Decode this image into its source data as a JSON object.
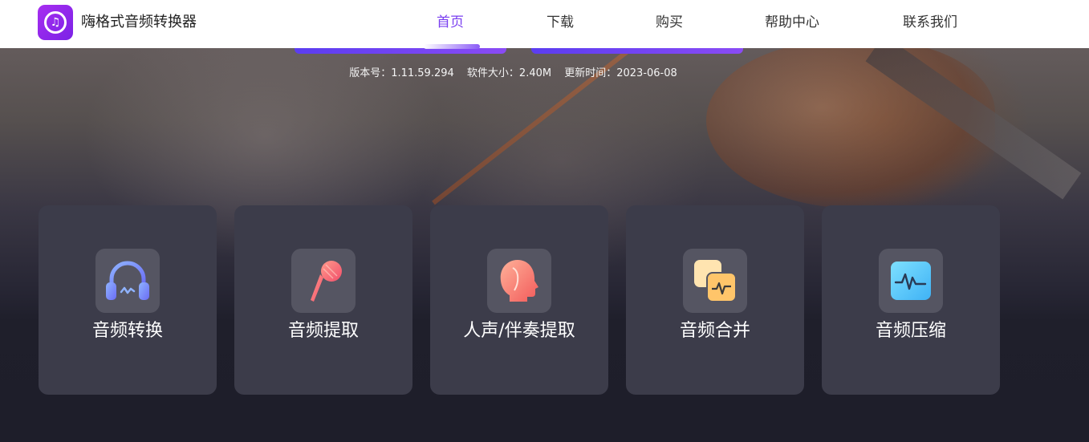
{
  "app": {
    "name": "嗨格式音频转换器",
    "logo_icon": "music-note-icon"
  },
  "nav": {
    "items": [
      {
        "label": "首页",
        "active": true
      },
      {
        "label": "下载",
        "active": false
      },
      {
        "label": "购买",
        "active": false
      },
      {
        "label": "帮助中心",
        "active": false
      },
      {
        "label": "联系我们",
        "active": false
      }
    ]
  },
  "colors": {
    "accent": "#7a3ff0",
    "card_bg": "#3c3c4a",
    "icon_box_bg": "#555562"
  },
  "version_info": {
    "version": "版本号：1.11.59.294",
    "size": "软件大小：2.40M",
    "updated": "更新时间：2023-06-08"
  },
  "features": [
    {
      "label": "音频转换",
      "icon": "headphones-icon"
    },
    {
      "label": "音频提取",
      "icon": "microphone-icon"
    },
    {
      "label": "人声/伴奏提取",
      "icon": "human-voice-icon"
    },
    {
      "label": "音频合并",
      "icon": "merge-waveform-icon"
    },
    {
      "label": "音频压缩",
      "icon": "compress-waveform-icon"
    }
  ]
}
